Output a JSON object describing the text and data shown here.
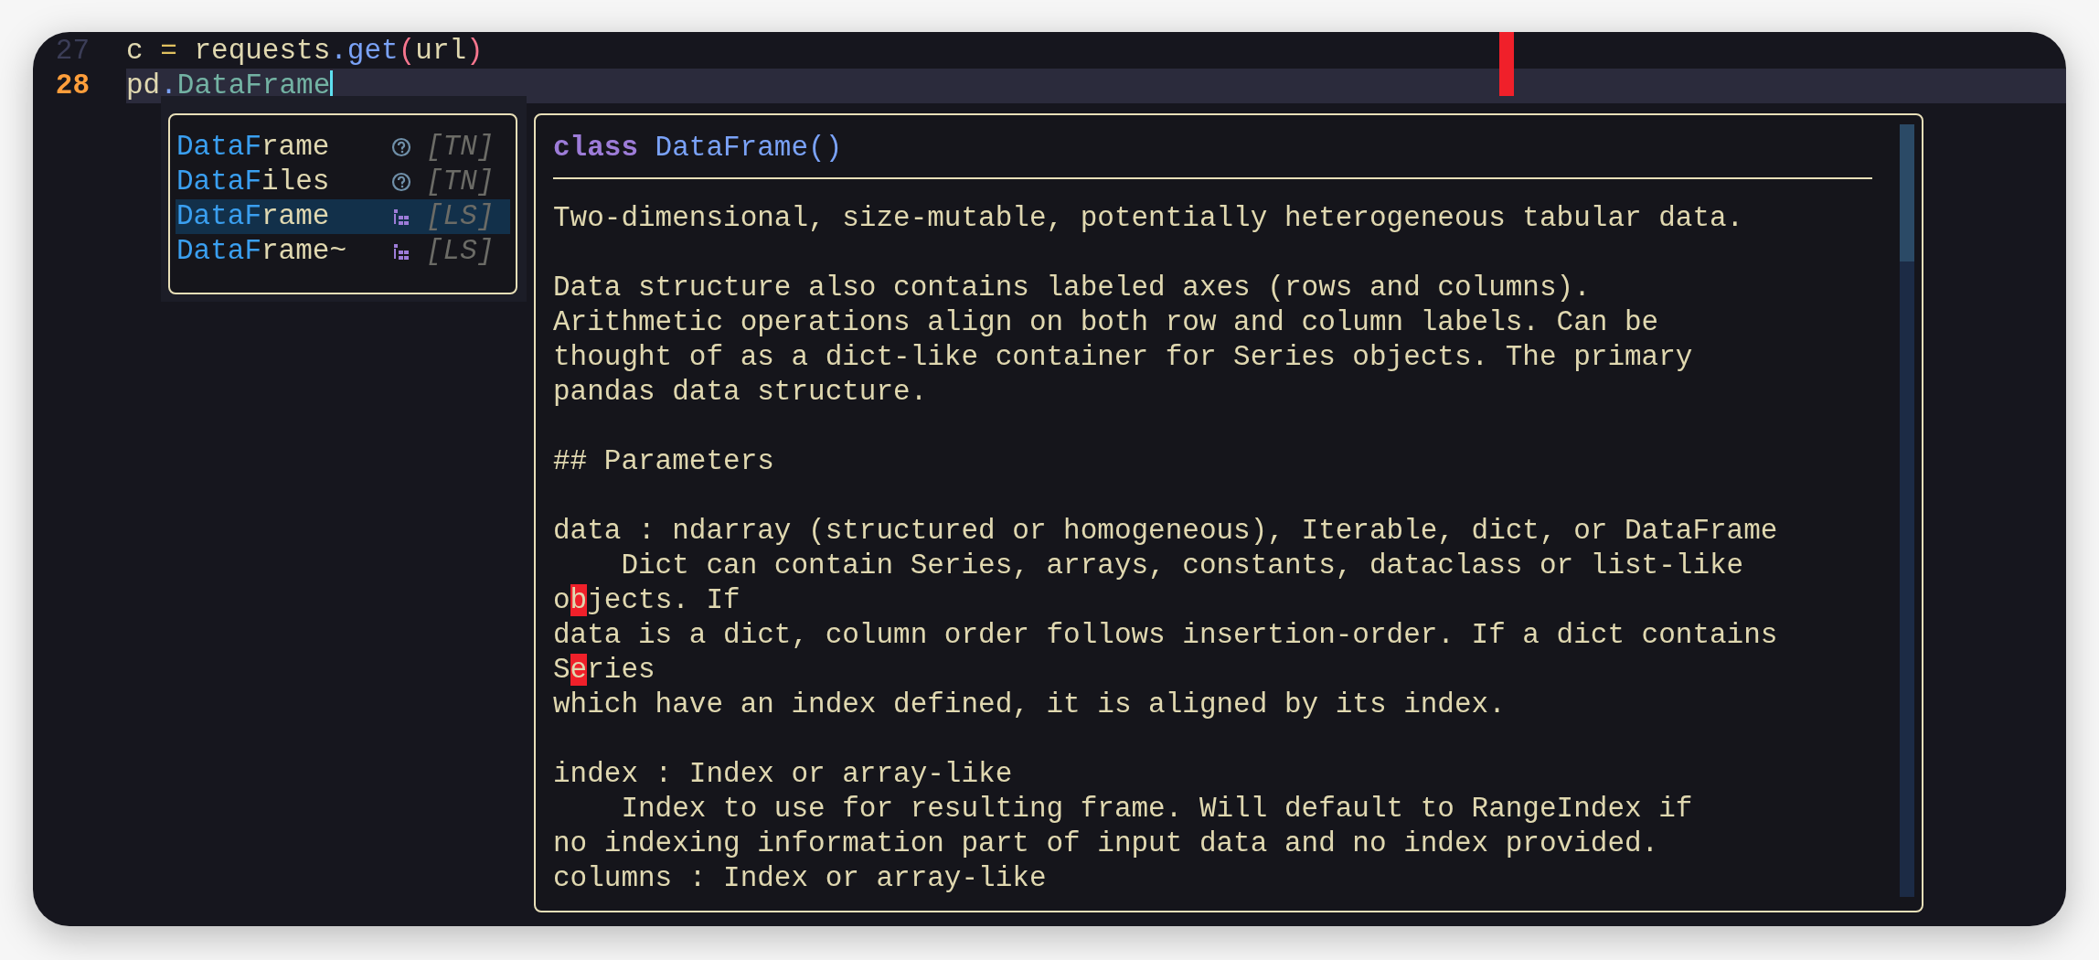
{
  "editor": {
    "lines": [
      {
        "number": "27",
        "current": false,
        "tokens": [
          {
            "text": "c",
            "kind": "plain"
          },
          {
            "text": " = ",
            "kind": "operator"
          },
          {
            "text": "requests",
            "kind": "plain"
          },
          {
            "text": ".",
            "kind": "punct"
          },
          {
            "text": "get",
            "kind": "function"
          },
          {
            "text": "(",
            "kind": "bracket"
          },
          {
            "text": "url",
            "kind": "plain"
          },
          {
            "text": ")",
            "kind": "bracket"
          }
        ]
      },
      {
        "number": "28",
        "current": true,
        "tokens": [
          {
            "text": "pd",
            "kind": "plain"
          },
          {
            "text": ".",
            "kind": "punct"
          },
          {
            "text": "DataFrame",
            "kind": "member"
          }
        ]
      }
    ]
  },
  "completion": {
    "items": [
      {
        "match": "DataF",
        "rest": "rame",
        "kind": "unknown",
        "source": "[TN]",
        "selected": false
      },
      {
        "match": "DataF",
        "rest": "iles",
        "kind": "unknown",
        "source": "[TN]",
        "selected": false
      },
      {
        "match": "DataF",
        "rest": "rame",
        "kind": "struct",
        "source": "[LS]",
        "selected": true
      },
      {
        "match": "DataF",
        "rest": "rame~",
        "kind": "struct",
        "source": "[LS]",
        "selected": false
      }
    ]
  },
  "documentation": {
    "signature": [
      {
        "text": "class",
        "kind": "keyword"
      },
      {
        "text": "DataFrame",
        "kind": "type"
      },
      {
        "text": "()",
        "kind": "punct"
      }
    ],
    "paragraphs": [
      {
        "lines": [
          {
            "segments": [
              {
                "text": "Two-dimensional, size-mutable, potentially heterogeneous tabular data."
              }
            ]
          }
        ]
      },
      {
        "lines": [
          {
            "segments": [
              {
                "text": "Data structure also contains labeled axes (rows and columns)."
              }
            ]
          },
          {
            "segments": [
              {
                "text": "Arithmetic operations align on both row and column labels. Can be"
              }
            ]
          },
          {
            "segments": [
              {
                "text": "thought of as a dict-like container for Series objects. The primary"
              }
            ]
          },
          {
            "segments": [
              {
                "text": "pandas data structure."
              }
            ]
          }
        ]
      },
      {
        "lines": [
          {
            "segments": [
              {
                "text": "## Parameters"
              }
            ]
          }
        ]
      },
      {
        "lines": [
          {
            "segments": [
              {
                "text": "data : ndarray (structured or homogeneous), Iterable, dict, or DataFrame"
              }
            ]
          },
          {
            "segments": [
              {
                "text": "    Dict can contain Series, arrays, constants, dataclass or list-like"
              }
            ]
          },
          {
            "segments": [
              {
                "text": "o"
              },
              {
                "text": "b",
                "marked": true
              },
              {
                "text": "jects. If"
              }
            ]
          },
          {
            "segments": [
              {
                "text": "data is a dict, column order follows insertion-order. If a dict contains"
              }
            ]
          },
          {
            "segments": [
              {
                "text": "S"
              },
              {
                "text": "e",
                "marked": true
              },
              {
                "text": "ries"
              }
            ]
          },
          {
            "segments": [
              {
                "text": "which have an index defined, it is aligned by its index."
              }
            ]
          }
        ]
      },
      {
        "lines": [
          {
            "segments": [
              {
                "text": "index : Index or array-like"
              }
            ]
          },
          {
            "segments": [
              {
                "text": "    Index to use for resulting frame. Will default to RangeIndex if"
              }
            ]
          },
          {
            "segments": [
              {
                "text": "no indexing information part of input data and no index provided."
              }
            ]
          },
          {
            "segments": [
              {
                "text": "columns : Index or array-like"
              }
            ]
          }
        ]
      }
    ]
  }
}
